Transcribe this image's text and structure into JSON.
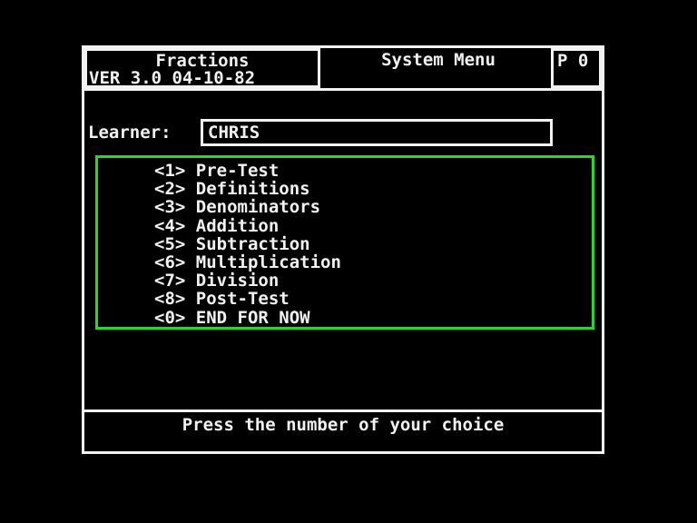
{
  "header": {
    "app_title": "Fractions",
    "version_line": "VER 3.0  04-10-82",
    "screen_title": "System Menu",
    "page_indicator": "P 0"
  },
  "learner": {
    "label": "Learner:",
    "value": "CHRIS"
  },
  "menu": {
    "items": [
      {
        "key": "<1>",
        "label": "Pre-Test"
      },
      {
        "key": "<2>",
        "label": "Definitions"
      },
      {
        "key": "<3>",
        "label": "Denominators"
      },
      {
        "key": "<4>",
        "label": "Addition"
      },
      {
        "key": "<5>",
        "label": "Subtraction"
      },
      {
        "key": "<6>",
        "label": "Multiplication"
      },
      {
        "key": "<7>",
        "label": "Division"
      },
      {
        "key": "<8>",
        "label": "Post-Test"
      },
      {
        "key": "<0>",
        "label": "END FOR NOW"
      }
    ]
  },
  "status": {
    "prompt": "Press the number of your choice"
  },
  "colors": {
    "background": "#000000",
    "foreground": "#f2f2f2",
    "menu_border": "#2bd62b"
  }
}
